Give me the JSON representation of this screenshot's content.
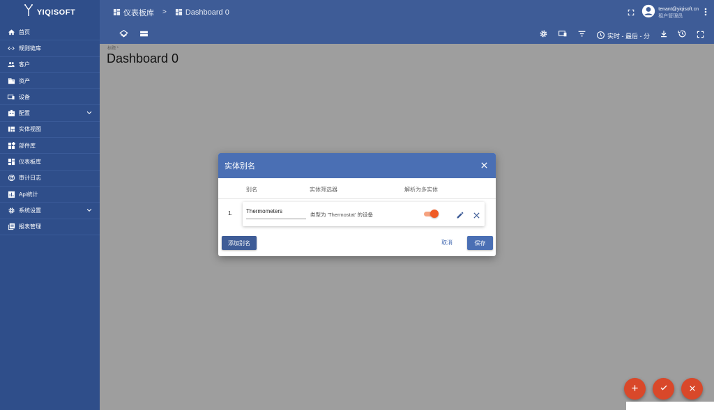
{
  "app": {
    "logo_text": "YIQISOFT"
  },
  "sidebar": {
    "items": [
      {
        "label": "首页",
        "icon": "home-icon"
      },
      {
        "label": "规则链库",
        "icon": "code-icon"
      },
      {
        "label": "客户",
        "icon": "people-icon"
      },
      {
        "label": "资产",
        "icon": "domain-icon"
      },
      {
        "label": "设备",
        "icon": "devices-icon"
      },
      {
        "label": "配置",
        "icon": "badge-icon",
        "expandable": true
      },
      {
        "label": "实体视图",
        "icon": "view-quilt-icon"
      },
      {
        "label": "部件库",
        "icon": "widgets-icon"
      },
      {
        "label": "仪表板库",
        "icon": "dashboards-icon"
      },
      {
        "label": "审计日志",
        "icon": "track-changes-icon"
      },
      {
        "label": "Api统计",
        "icon": "insert-chart-icon"
      },
      {
        "label": "系统设置",
        "icon": "settings-icon",
        "expandable": true
      },
      {
        "label": "报表管理",
        "icon": "library-books-icon"
      }
    ]
  },
  "header": {
    "breadcrumb": {
      "parent": "仪表板库",
      "separator": ">",
      "current": "Dashboard 0"
    },
    "user": {
      "email": "tenant@yiqisoft.cn",
      "role": "租户管理员"
    }
  },
  "toolbar": {
    "time_window": "实时 - 最后 - 分"
  },
  "main": {
    "title_label": "标题 *",
    "title_value": "Dashboard 0"
  },
  "dialog": {
    "title": "实体别名",
    "columns": {
      "alias": "别名",
      "filter": "实体筛选器",
      "resolve_multiple": "解析为多实体"
    },
    "rows": [
      {
        "index": "1.",
        "alias": "Thermometers",
        "filter": "类型为 'Thermostat' 的设备",
        "resolve_multiple": true
      }
    ],
    "add_label": "添加别名",
    "cancel_label": "取消",
    "save_label": "保存"
  },
  "colors": {
    "sidebar": "#2f4e8a",
    "header": "#3e5c97",
    "dialog_header": "#4a6fb4",
    "accent": "#d9482a"
  }
}
